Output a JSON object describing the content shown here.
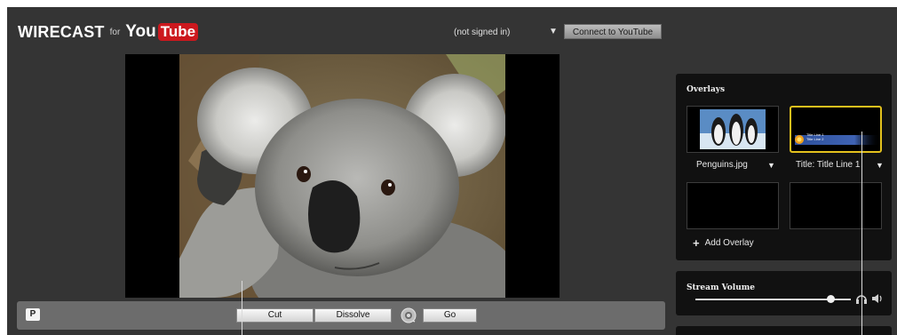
{
  "header": {
    "logo_wirecast": "WIRECAST",
    "logo_for": "for",
    "logo_you": "You",
    "logo_tube": "Tube",
    "signin_status": "(not signed in)",
    "connect_button": "Connect to YouTube"
  },
  "controls": {
    "p_label": "P",
    "cut": "Cut",
    "dissolve": "Dissolve",
    "go": "Go"
  },
  "overlays": {
    "title": "Overlays",
    "items": [
      {
        "caption": "Penguins.jpg"
      },
      {
        "caption": "Title: Title Line 1",
        "thumb_line1": "Title Line 1",
        "thumb_line2": "Title Line 2"
      }
    ],
    "add_label": "Add Overlay"
  },
  "stream_volume": {
    "title": "Stream Volume",
    "level": 0.87
  },
  "colors": {
    "background": "#343434",
    "panel": "#111111",
    "selection": "#e3c11d",
    "youtube_red": "#cc181e"
  }
}
